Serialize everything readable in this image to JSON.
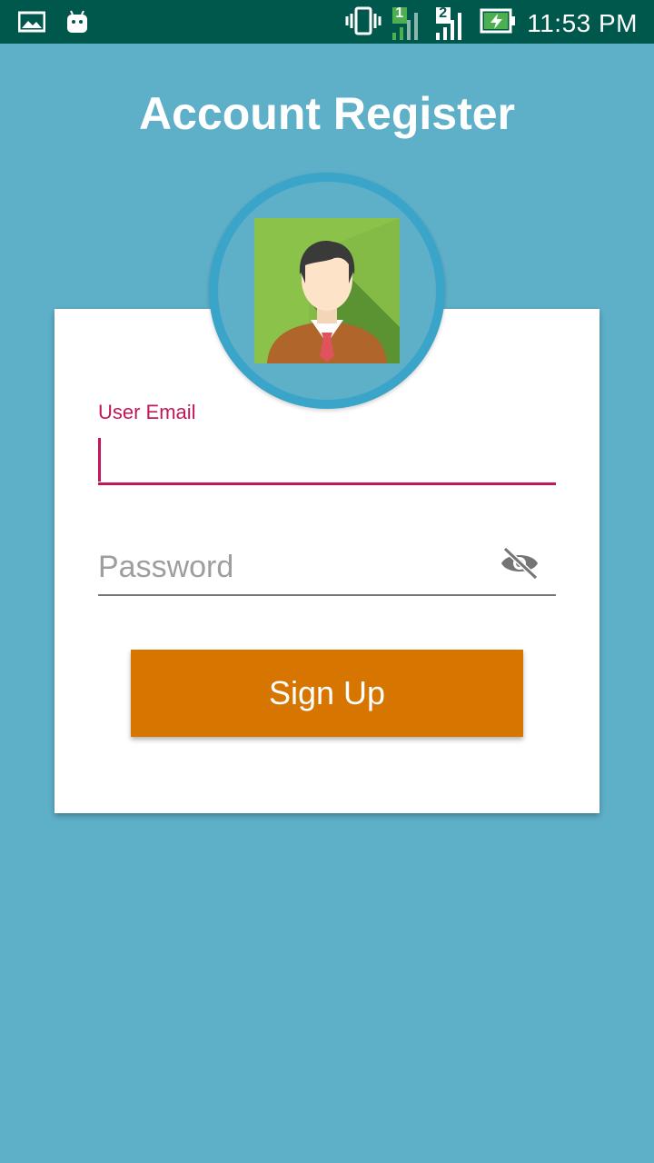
{
  "status_bar": {
    "time": "11:53 PM",
    "sim1": "1",
    "sim2": "2",
    "icons": [
      "gallery-icon",
      "android-icon",
      "vibrate-icon",
      "signal-sim1-icon",
      "signal-sim2-icon",
      "battery-charging-icon"
    ]
  },
  "title": "Account Register",
  "form": {
    "email_label": "User Email",
    "email_value": "",
    "password_placeholder": "Password",
    "password_value": "",
    "signup_label": "Sign Up"
  },
  "colors": {
    "background": "#5eafc8",
    "status_bar": "#00574b",
    "accent": "#c2185b",
    "button": "#d67600",
    "avatar_ring": "#3aa5c8"
  }
}
